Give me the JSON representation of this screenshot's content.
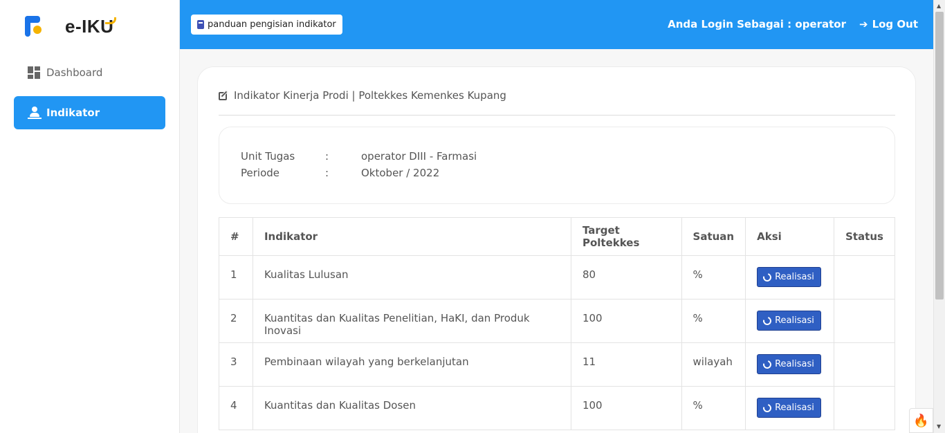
{
  "app": {
    "logo_text": "e-IKU"
  },
  "sidebar": {
    "items": [
      {
        "label": "Dashboard",
        "icon": "dashboard-icon",
        "active": false
      },
      {
        "label": "Indikator",
        "icon": "user-icon",
        "active": true
      }
    ]
  },
  "topbar": {
    "guide_label": "panduan pengisian indikator",
    "login_info": "Anda Login Sebagai : operator",
    "logout_label": "Log Out"
  },
  "main": {
    "title": "Indikator Kinerja Prodi | Poltekkes Kemenkes Kupang",
    "info": {
      "unit_label": "Unit Tugas",
      "unit_value": "operator DIII - Farmasi",
      "periode_label": "Periode",
      "periode_value": "Oktober / 2022",
      "separator": ":"
    },
    "table": {
      "headers": [
        "#",
        "Indikator",
        "Target Poltekkes",
        "Satuan",
        "Aksi",
        "Status"
      ],
      "rows": [
        {
          "no": "1",
          "indikator": "Kualitas Lulusan",
          "target": "80",
          "satuan": "%",
          "aksi": "Realisasi",
          "status": ""
        },
        {
          "no": "2",
          "indikator": "Kuantitas dan Kualitas Penelitian, HaKI, dan Produk Inovasi",
          "target": "100",
          "satuan": "%",
          "aksi": "Realisasi",
          "status": ""
        },
        {
          "no": "3",
          "indikator": "Pembinaan wilayah yang berkelanjutan",
          "target": "11",
          "satuan": "wilayah",
          "aksi": "Realisasi",
          "status": ""
        },
        {
          "no": "4",
          "indikator": "Kuantitas dan Kualitas Dosen",
          "target": "100",
          "satuan": "%",
          "aksi": "Realisasi",
          "status": ""
        }
      ]
    }
  },
  "colors": {
    "primary": "#2196f3",
    "button": "#2f5fc3",
    "logo_accent": "#f5b301"
  }
}
